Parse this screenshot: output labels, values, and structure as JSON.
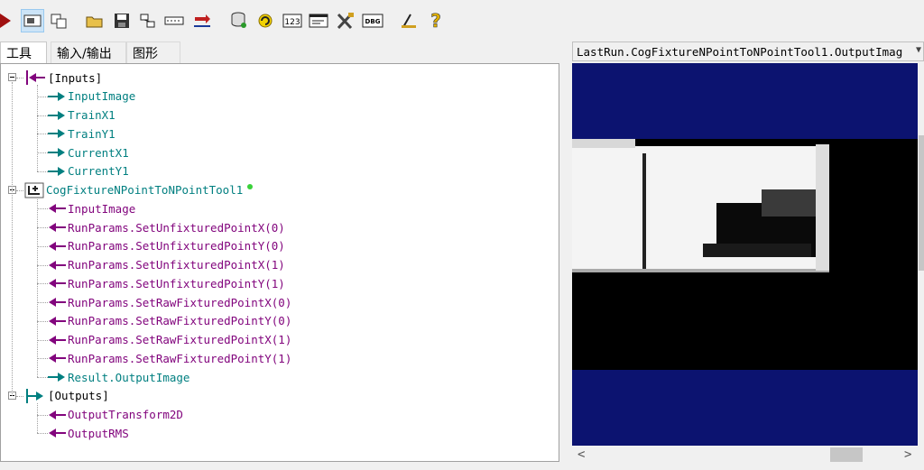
{
  "toolbar": {
    "icons": [
      "run-icon",
      "image-view-icon",
      "copy-icon",
      "open-folder-icon",
      "save-icon",
      "network-icon",
      "dotted-line-icon",
      "import-icon",
      "database-icon",
      "refresh-icon",
      "numeric-icon",
      "terminal-icon",
      "tools-icon",
      "debug-icon",
      "wizard-icon",
      "help-icon"
    ],
    "numeric_label": "123",
    "debug_label": "DBG"
  },
  "tabs": [
    "工具",
    "输入/输出",
    "图形"
  ],
  "tree": {
    "inputs_header": "[Inputs]",
    "inputs": [
      "InputImage",
      "TrainX1",
      "TrainY1",
      "CurrentX1",
      "CurrentY1"
    ],
    "tool_name": "CogFixtureNPointToNPointTool1",
    "tool_items": [
      "InputImage",
      "RunParams.SetUnfixturedPointX(0)",
      "RunParams.SetUnfixturedPointY(0)",
      "RunParams.SetUnfixturedPointX(1)",
      "RunParams.SetUnfixturedPointY(1)",
      "RunParams.SetRawFixturedPointX(0)",
      "RunParams.SetRawFixturedPointY(0)",
      "RunParams.SetRawFixturedPointX(1)",
      "RunParams.SetRawFixturedPointY(1)",
      "Result.OutputImage"
    ],
    "outputs_header": "[Outputs]",
    "outputs": [
      "OutputTransform2D",
      "OutputRMS"
    ]
  },
  "image_panel": {
    "title": "LastRun.CogFixtureNPointToNPointTool1.OutputImag"
  },
  "colors": {
    "teal": "#007f80",
    "purple": "#82057d",
    "image_background": "#0c1370"
  }
}
